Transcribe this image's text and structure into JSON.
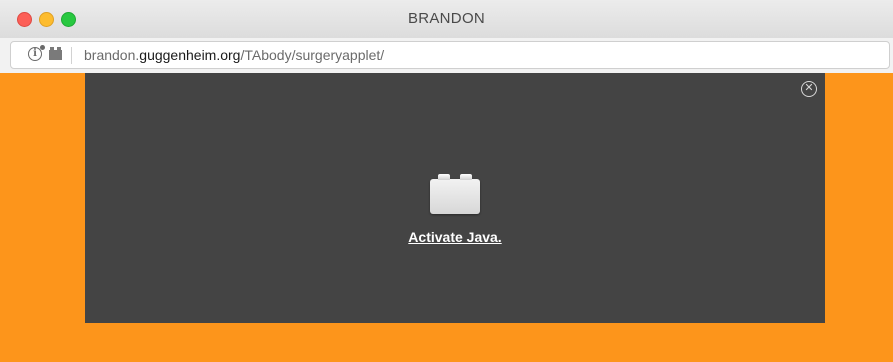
{
  "window": {
    "title": "BRANDON"
  },
  "addressbar": {
    "url_prefix": "brandon.",
    "url_domain": "guggenheim.org",
    "url_path": "/TAbody/surgeryapplet/",
    "info_icon": "info-icon",
    "plugin_icon": "plugin-icon"
  },
  "content": {
    "background_color": "#fd951b",
    "applet": {
      "background_color": "#444444",
      "close_symbol": "✕",
      "brick_icon": "java-plugin-icon",
      "activate_label": "Activate Java."
    }
  }
}
